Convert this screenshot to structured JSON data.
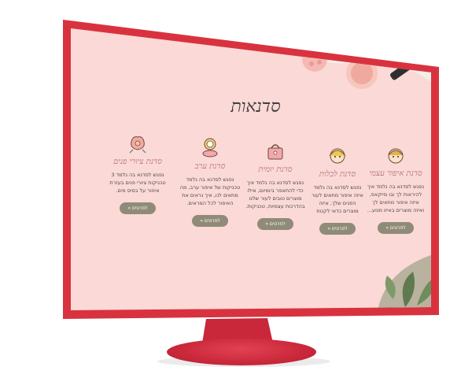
{
  "page": {
    "title": "סדנאות"
  },
  "cards": [
    {
      "title": "סדנת איפור עצמי",
      "lines": [
        "נפגש לסדנא בה נלמד איך",
        "להיראות לך ובו מייקאפ,",
        "איזה איפור מתאים לך",
        "ואיזה מוצרים באיזו מנוע..."
      ],
      "button": "לפרטים »",
      "icon": "woman-face-icon"
    },
    {
      "title": "סדנת לכלות",
      "lines": [
        "נפגש לסדנא בה נלמד",
        "איזה איפור מתאים לעור",
        "הפנים שלך, איזה",
        "מוצרים כדאי לקנות"
      ],
      "button": "לפרטים »",
      "icon": "bride-icon"
    },
    {
      "title": "סדנת יומית",
      "lines": [
        "נפגש לסדנא בה נלמד איך",
        "כדי להתאפר ביומיום, אילו",
        "מוצרים טובים לעור שלנו",
        "בהדרכות עצמיות, טכניקות."
      ],
      "button": "לפרטים »",
      "icon": "handbag-icon"
    },
    {
      "title": "סדנת ערב",
      "lines": [
        "נפגש לסדנא בה נלמד",
        "טכניקות של איפור ערב, מה",
        "מתאים לנו, איך נראים את",
        "האיפור לכל המראים."
      ],
      "button": "לפרטים »",
      "icon": "compact-mirror-icon"
    },
    {
      "title": "סדנת ציורי פנים",
      "lines": [
        "נפגש לסדנא בה נלמד 3",
        "טכניקות ציורי פנים בעזרת",
        "איפור על בסיס מים."
      ],
      "button": "לפרטים »",
      "icon": "flower-icon"
    }
  ],
  "colors": {
    "bezel": "#d9323f",
    "screen_bg": "#fbd9d6",
    "button_bg": "#8f8b78",
    "card_title": "#b5727a"
  }
}
